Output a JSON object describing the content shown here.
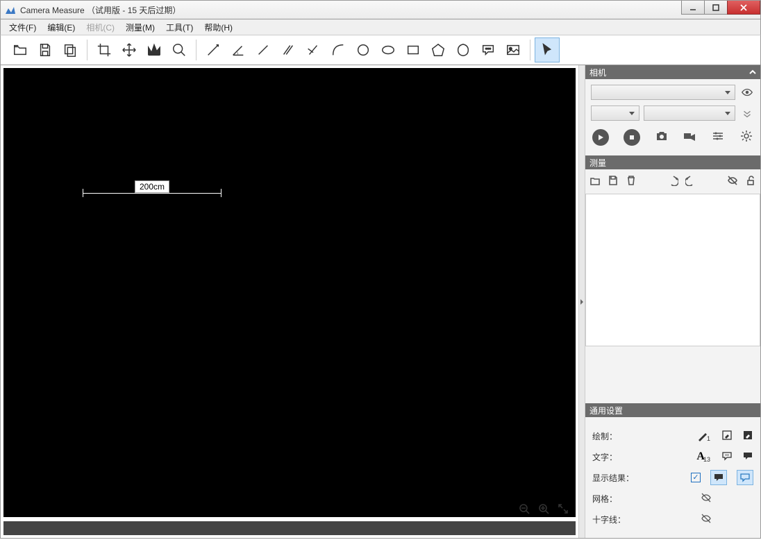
{
  "window": {
    "title": "Camera Measure （试用版 - 15 天后过期）"
  },
  "menu": {
    "file": "文件(F)",
    "edit": "编辑(E)",
    "camera": "相机(C)",
    "measure": "测量(M)",
    "tools": "工具(T)",
    "help": "帮助(H)"
  },
  "canvas": {
    "measurement_label": "200cm"
  },
  "panels": {
    "camera": {
      "title": "相机"
    },
    "measure": {
      "title": "测量"
    },
    "settings": {
      "title": "通用设置",
      "draw_label": "绘制：",
      "text_label": "文字：",
      "result_label": "显示结果：",
      "grid_label": "网格：",
      "cross_label": "十字线：",
      "pen_size": "1",
      "font_size": "13"
    }
  }
}
